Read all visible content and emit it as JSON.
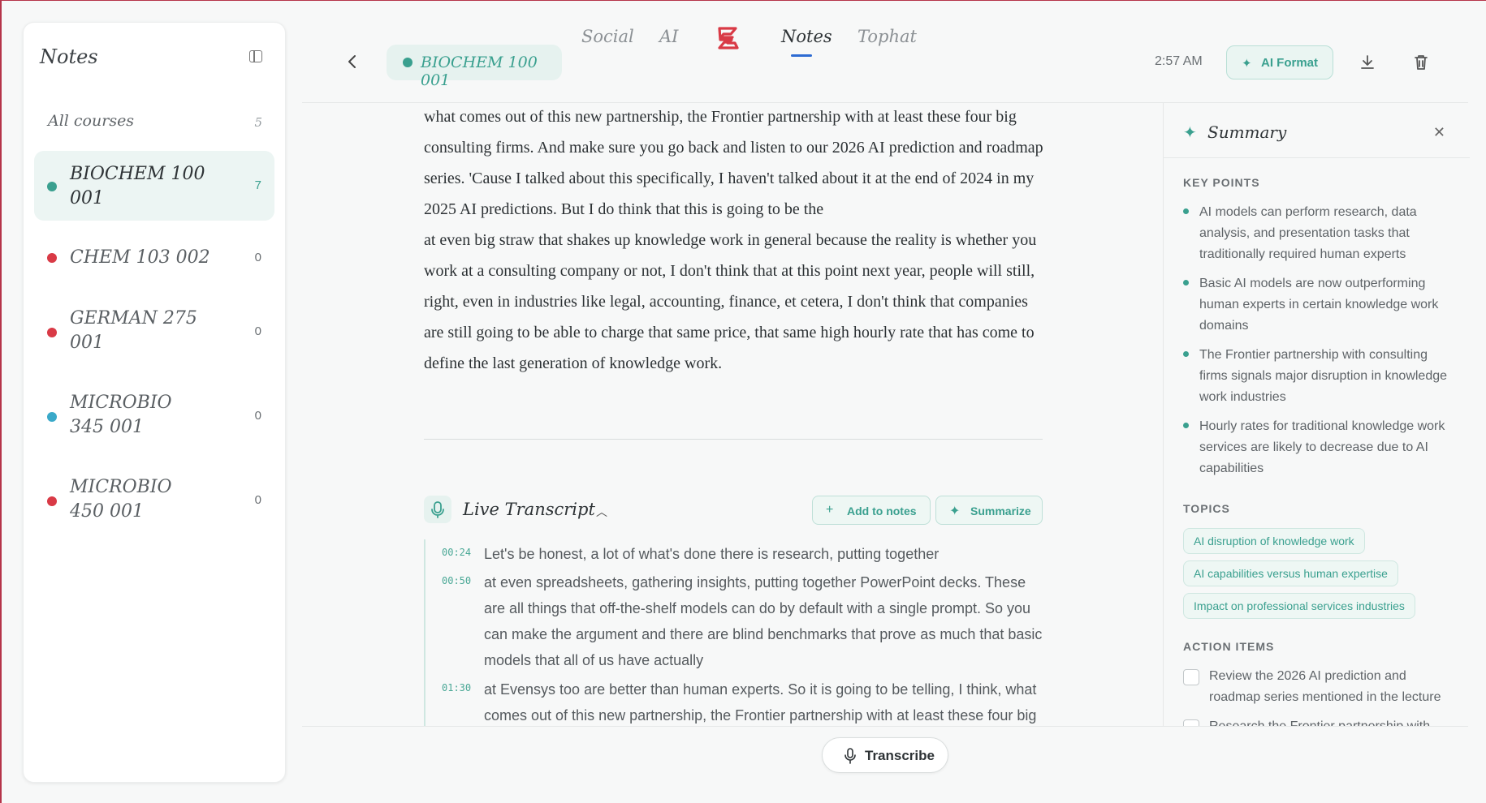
{
  "sidebar": {
    "title": "Notes",
    "all_courses": {
      "label": "All courses",
      "count": "5"
    },
    "courses": [
      {
        "name": "BIOCHEM 100 001",
        "count": "7",
        "color": "#3aa08f",
        "active": true
      },
      {
        "name": "CHEM 103 002",
        "count": "0",
        "color": "#d93a46"
      },
      {
        "name": "GERMAN 275 001",
        "count": "0",
        "color": "#d93a46"
      },
      {
        "name": "MICROBIO 345 001",
        "count": "0",
        "color": "#3aa9c9"
      },
      {
        "name": "MICROBIO 450 001",
        "count": "0",
        "color": "#d93a46"
      }
    ]
  },
  "nav": {
    "items": [
      "Social",
      "AI",
      "Notes",
      "Tophat"
    ],
    "active": "Notes",
    "logo_icon": "brand-logo-icon",
    "logo_color": "#d93a46",
    "underline_color": "#2d6bd2"
  },
  "header": {
    "course_pill": "BIOCHEM 100 001",
    "time": "2:57 AM",
    "ai_format_label": "AI Format"
  },
  "note": {
    "paragraph1": "what comes out of this new partnership, the Frontier partnership with at least these four big consulting firms. And make sure you go back and listen to our 2026 AI prediction and roadmap series. 'Cause I talked about this specifically, I haven't talked about it at the end of 2024 in my 2025 AI predictions. But I do think that this is going to be the",
    "paragraph2": "at even big straw that shakes up knowledge work in general because the reality is whether you work at a consulting company or not, I don't think that at this point next year, people will still, right, even in industries like legal, accounting, finance, et cetera, I don't think that companies are still going to be able to charge that same price, that same high hourly rate that has come to define the last generation of knowledge work."
  },
  "live_transcript": {
    "title": "Live Transcript",
    "add_to_notes": "Add to notes",
    "summarize": "Summarize",
    "entries": [
      {
        "time": "00:24",
        "text": "Let's be honest, a lot of what's done there is research, putting together"
      },
      {
        "time": "00:50",
        "text": "at even spreadsheets, gathering insights, putting together PowerPoint decks. These are all things that off-the-shelf models can do by default with a single prompt. So you can make the argument and there are blind benchmarks that prove as much that basic models that all of us have actually"
      },
      {
        "time": "01:30",
        "text": "at Evensys too are better than human experts. So it is going to be telling, I think, what comes out of this new partnership, the Frontier partnership with at least these four big"
      }
    ]
  },
  "transcribe_label": "Transcribe",
  "summary": {
    "title": "Summary",
    "key_points_title": "KEY POINTS",
    "key_points": [
      "AI models can perform research, data analysis, and presentation tasks that traditionally required human experts",
      "Basic AI models are now outperforming human experts in certain knowledge work domains",
      "The Frontier partnership with consulting firms signals major disruption in knowledge work industries",
      "Hourly rates for traditional knowledge work services are likely to decrease due to AI capabilities"
    ],
    "topics_title": "TOPICS",
    "topics": [
      "AI disruption of knowledge work",
      "AI capabilities versus human expertise",
      "Impact on professional services industries"
    ],
    "action_items_title": "ACTION ITEMS",
    "action_items": [
      "Review the 2026 AI prediction and roadmap series mentioned in the lecture",
      "Research the Frontier partnership with"
    ]
  }
}
